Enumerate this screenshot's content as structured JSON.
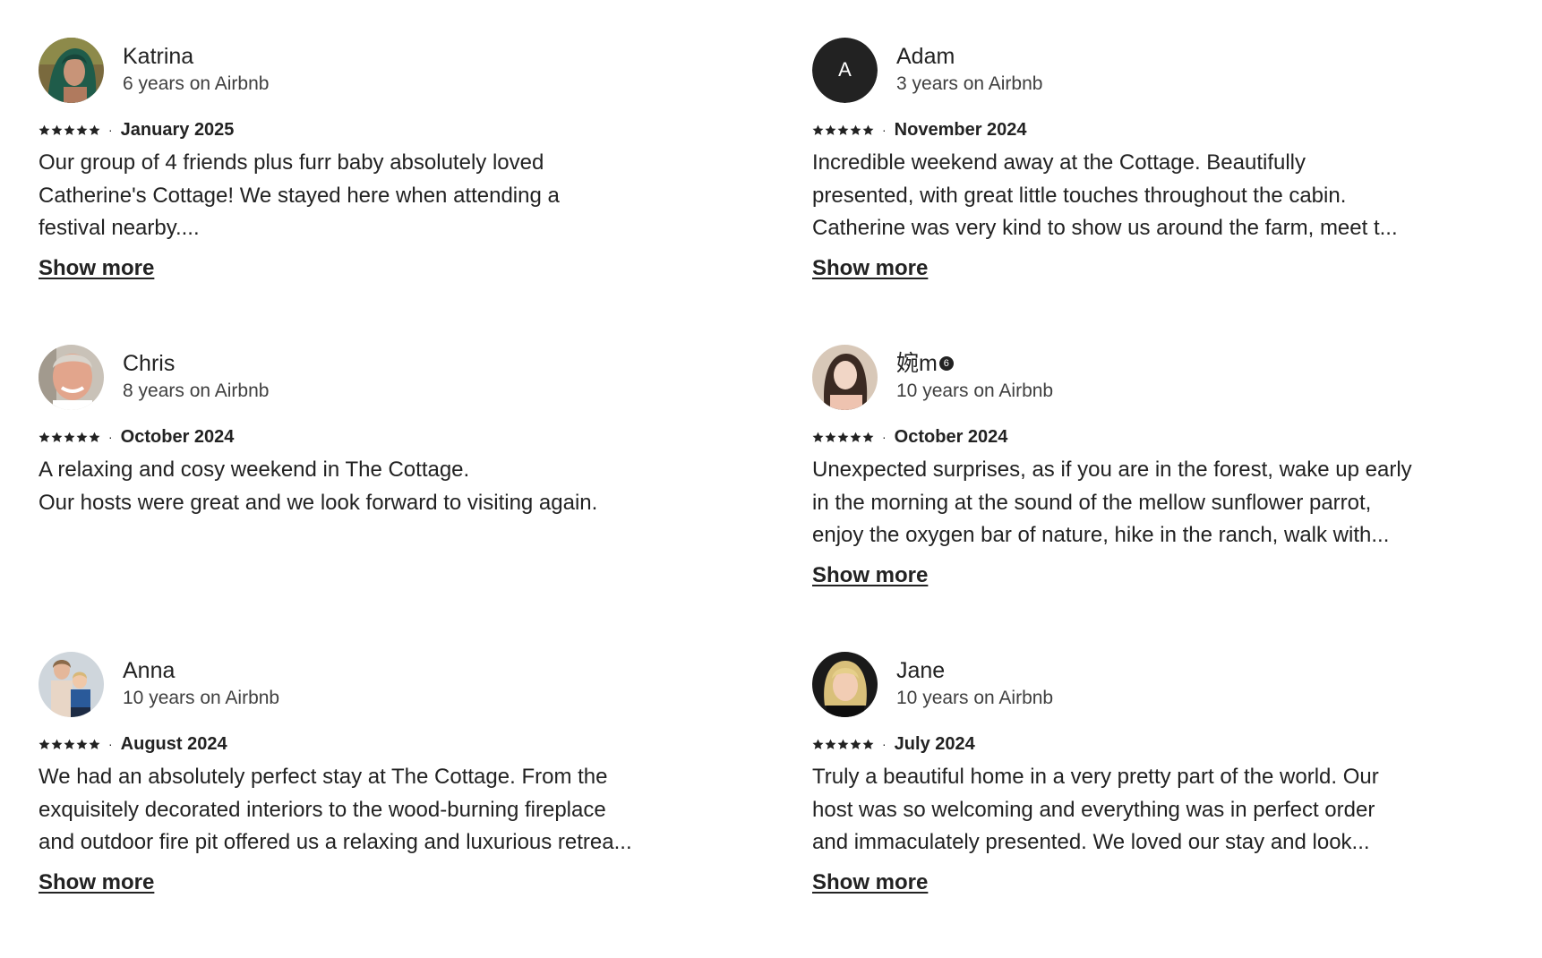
{
  "reviews": [
    {
      "name": "Katrina",
      "tenure": "6 years on Airbnb",
      "avatar": "photo-woman-dark-hair",
      "separator": "·",
      "date": "January 2025",
      "lines": [
        "Our group of 4 friends plus furr baby absolutely loved",
        "Catherine's Cottage! We stayed here when attending a",
        "festival nearby...."
      ],
      "show_more": "Show more"
    },
    {
      "name": "Adam",
      "tenure": "3 years on Airbnb",
      "avatar_letter": "A",
      "separator": "·",
      "date": "November 2024",
      "lines": [
        "Incredible weekend away at the Cottage. Beautifully",
        "presented, with great little touches throughout the cabin.",
        "Catherine was very kind to show us around the farm, meet t..."
      ],
      "show_more": "Show more"
    },
    {
      "name": "Chris",
      "tenure": "8 years on Airbnb",
      "avatar": "photo-man-smiling",
      "separator": "·",
      "date": "October 2024",
      "lines": [
        "A relaxing and cosy weekend in The Cottage.",
        "Our hosts were great and we look forward to visiting again."
      ]
    },
    {
      "name": "婉m",
      "badge": "6",
      "tenure": "10 years on Airbnb",
      "avatar": "photo-woman-light",
      "separator": "·",
      "date": "October 2024",
      "lines": [
        "Unexpected surprises, as if you are in the forest, wake up early",
        "in the morning at the sound of the mellow sunflower parrot,",
        "enjoy the oxygen bar of nature, hike in the ranch, walk with..."
      ],
      "show_more": "Show more"
    },
    {
      "name": "Anna",
      "tenure": "10 years on Airbnb",
      "avatar": "photo-woman-and-child",
      "separator": "·",
      "date": "August 2024",
      "lines": [
        "We had an absolutely perfect stay at The Cottage. From the",
        "exquisitely decorated interiors to the wood-burning fireplace",
        "and outdoor fire pit offered us a relaxing and luxurious retrea..."
      ],
      "show_more": "Show more"
    },
    {
      "name": "Jane",
      "tenure": "10 years on Airbnb",
      "avatar": "photo-woman-blonde",
      "separator": "·",
      "date": "July 2024",
      "lines": [
        "Truly a beautiful home in a very pretty part of the world. Our",
        "host was so welcoming and everything was in perfect order",
        "and immaculately presented. We loved our stay and look..."
      ],
      "show_more": "Show more"
    }
  ],
  "rating_stars": 5,
  "colors": {
    "text": "#222222",
    "secondary_text": "#3f3f3f",
    "background": "#ffffff",
    "avatar_letter_bg": "#222222"
  }
}
